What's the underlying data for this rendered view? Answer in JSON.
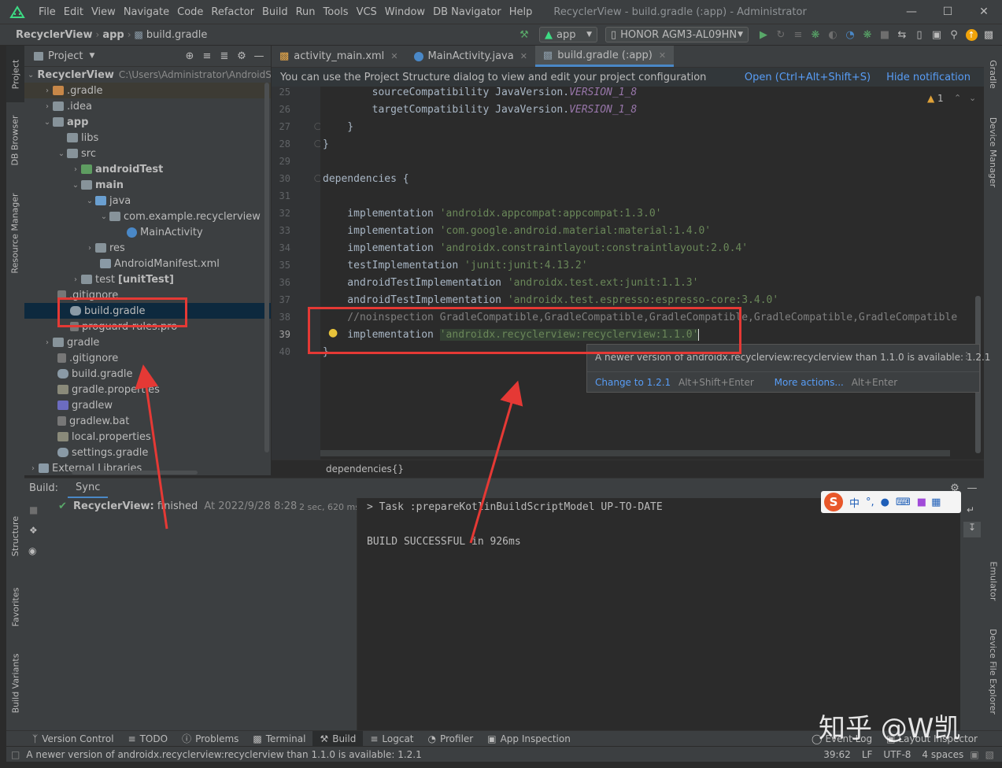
{
  "menu": {
    "items": [
      "File",
      "Edit",
      "View",
      "Navigate",
      "Code",
      "Refactor",
      "Build",
      "Run",
      "Tools",
      "VCS",
      "Window",
      "DB Navigator",
      "Help"
    ],
    "window_title": "RecyclerView - build.gradle (:app) - Administrator"
  },
  "breadcrumbs": [
    "RecyclerView",
    "app",
    "build.gradle"
  ],
  "toolbar": {
    "config": "app",
    "device": "HONOR AGM3-AL09HN"
  },
  "left_strip": [
    "Project",
    "DB Browser",
    "Resource Manager",
    "Structure",
    "Favorites",
    "Build Variants"
  ],
  "right_strip": [
    "Gradle",
    "Device Manager",
    "Emulator",
    "Device File Explorer"
  ],
  "project_panel": {
    "title": "Project",
    "root": {
      "name": "RecyclerView",
      "path": "C:\\Users\\Administrator\\AndroidStudioProjects\\RecyclerView"
    },
    "tree": [
      {
        "label": ".gradle",
        "icon": "folder-orange-icon"
      },
      {
        "label": ".idea",
        "icon": "folder-icon"
      },
      {
        "label": "app",
        "icon": "module-folder-icon"
      },
      {
        "label": "libs",
        "icon": "folder-icon"
      },
      {
        "label": "src",
        "icon": "folder-icon"
      },
      {
        "label": "androidTest",
        "icon": "test-folder-icon"
      },
      {
        "label": "main",
        "icon": "folder-icon"
      },
      {
        "label": "java",
        "icon": "source-folder-icon"
      },
      {
        "label": "com.example.recyclerview",
        "icon": "package-icon"
      },
      {
        "label": "MainActivity",
        "icon": "class-icon"
      },
      {
        "label": "res",
        "icon": "res-folder-icon"
      },
      {
        "label": "AndroidManifest.xml",
        "icon": "manifest-icon"
      },
      {
        "label": "test",
        "extra": "[unitTest]",
        "icon": "test-folder-icon"
      },
      {
        "label": ".gitignore",
        "icon": "file-icon"
      },
      {
        "label": "build.gradle",
        "icon": "gradle-icon"
      },
      {
        "label": "proguard-rules.pro",
        "icon": "file-icon"
      },
      {
        "label": "gradle",
        "icon": "folder-icon"
      },
      {
        "label": ".gitignore",
        "icon": "file-icon"
      },
      {
        "label": "build.gradle",
        "icon": "gradle-icon"
      },
      {
        "label": "gradle.properties",
        "icon": "properties-icon"
      },
      {
        "label": "gradlew",
        "icon": "script-icon"
      },
      {
        "label": "gradlew.bat",
        "icon": "file-icon"
      },
      {
        "label": "local.properties",
        "icon": "properties-icon"
      },
      {
        "label": "settings.gradle",
        "icon": "gradle-icon"
      },
      {
        "label": "External Libraries",
        "icon": "library-icon"
      }
    ]
  },
  "editor": {
    "tabs": [
      "activity_main.xml",
      "MainActivity.java",
      "build.gradle (:app)"
    ],
    "notification": {
      "text": "You can use the Project Structure dialog to view and edit your project configuration",
      "open_link": "Open (Ctrl+Alt+Shift+S)",
      "hide_link": "Hide notification"
    },
    "warnings": "1",
    "line_numbers": [
      "25",
      "26",
      "27",
      "28",
      "29",
      "30",
      "31",
      "32",
      "33",
      "34",
      "35",
      "36",
      "37",
      "38",
      "39",
      "40"
    ],
    "lines": {
      "l25_kw": "        sourceCompatibility JavaVersion.",
      "l25_c": "VERSION_1_8",
      "l26_kw": "        targetCompatibility JavaVersion.",
      "l26_c": "VERSION_1_8",
      "l27": "    }",
      "l28": "}",
      "l30": "dependencies {",
      "l32_kw": "    implementation ",
      "l32_s": "'androidx.appcompat:appcompat:1.3.0'",
      "l33_kw": "    implementation ",
      "l33_s": "'com.google.android.material:material:1.4.0'",
      "l34_kw": "    implementation ",
      "l34_s": "'androidx.constraintlayout:constraintlayout:2.0.4'",
      "l35_kw": "    testImplementation ",
      "l35_s": "'junit:junit:4.13.2'",
      "l36_kw": "    androidTestImplementation ",
      "l36_s": "'androidx.test.ext:junit:1.1.3'",
      "l37_kw": "    androidTestImplementation ",
      "l37_s": "'androidx.test.espresso:espresso-core:3.4.0'",
      "l38": "    //noinspection GradleCompatible,GradleCompatible,GradleCompatible,GradleCompatible,GradleCompatible",
      "l39_kw": "    implementation ",
      "l39_s": "'androidx.recyclerview:recyclerview:1.1.0'",
      "l40": "}"
    },
    "breadcrumb": "dependencies{}",
    "popup": {
      "message": "A newer version of androidx.recyclerview:recyclerview than 1.1.0 is available: 1.2.1",
      "action": "Change to 1.2.1",
      "action_shortcut": "Alt+Shift+Enter",
      "more": "More actions...",
      "more_shortcut": "Alt+Enter"
    }
  },
  "build": {
    "label": "Build:",
    "tab": "Sync",
    "task_name": "RecyclerView:",
    "task_status": "finished",
    "task_time": "At 2022/9/28 8:28",
    "duration": "2 sec, 620 ms",
    "console": [
      "> Task :prepareKotlinBuildScriptModel UP-TO-DATE",
      "",
      "BUILD SUCCESSFUL in 926ms"
    ]
  },
  "ime": {
    "zh": "中"
  },
  "bottom_tabs": [
    "Version Control",
    "TODO",
    "Problems",
    "Terminal",
    "Build",
    "Logcat",
    "Profiler",
    "App Inspection",
    "Event Log",
    "Layout Inspector"
  ],
  "watermark": "知乎 @W凯",
  "status": {
    "message": "A newer version of androidx.recyclerview:recyclerview than 1.1.0 is available: 1.2.1",
    "position": "39:62",
    "line_sep": "LF",
    "encoding": "UTF-8",
    "indent": "4 spaces"
  },
  "colors": {
    "accent": "#4a88c7",
    "highlight_box": "#e53935",
    "string": "#6a8759",
    "constant": "#9876aa"
  }
}
